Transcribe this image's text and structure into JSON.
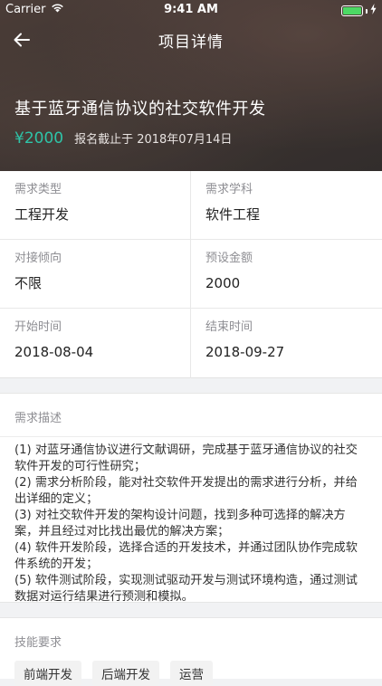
{
  "status_bar": {
    "carrier": "Carrier",
    "time": "9:41 AM",
    "battery_level": 1.0
  },
  "nav": {
    "title": "项目详情",
    "back_icon": "arrow-left-icon"
  },
  "project": {
    "title": "基于蓝牙通信协议的社交软件开发",
    "price": "¥2000",
    "deadline": "报名截止于 2018年07月14日"
  },
  "info": [
    [
      {
        "label": "需求类型",
        "value": "工程开发"
      },
      {
        "label": "需求学科",
        "value": "软件工程"
      }
    ],
    [
      {
        "label": "对接倾向",
        "value": "不限"
      },
      {
        "label": "预设金额",
        "value": "2000"
      }
    ],
    [
      {
        "label": "开始时间",
        "value": "2018-08-04"
      },
      {
        "label": "结束时间",
        "value": "2018-09-27"
      }
    ]
  ],
  "description": {
    "title": "需求描述",
    "items": [
      "(1) 对蓝牙通信协议进行文献调研，完成基于蓝牙通信协议的社交软件开发的可行性研究；",
      "(2) 需求分析阶段，能对社交软件开发提出的需求进行分析，并给出详细的定义；",
      "(3) 对社交软件开发的架构设计问题，找到多种可选择的解决方案，并且经过对比找出最优的解决方案；",
      "(4) 软件开发阶段，选择合适的开发技术，并通过团队协作完成软件系统的开发；",
      "(5) 软件测试阶段，实现测试驱动开发与测试环境构造，通过测试数据对运行结果进行预测和模拟。"
    ]
  },
  "skills": {
    "title": "技能要求",
    "tags": [
      "前端开发",
      "后端开发",
      "运营"
    ]
  },
  "colors": {
    "accent": "#2ec4a8",
    "battery": "#4cd964"
  }
}
